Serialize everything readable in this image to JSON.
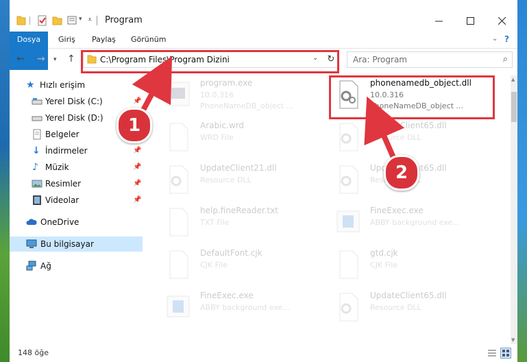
{
  "window": {
    "title": "Program"
  },
  "ribbon": {
    "tabs": [
      "Dosya",
      "Giriş",
      "Paylaş",
      "Görünüm"
    ]
  },
  "navigation": {
    "address": "C:\\Program Files\\Program Dizini",
    "search_placeholder": "Ara: Program"
  },
  "sidebar": {
    "items": [
      {
        "label": "Hızlı erişim",
        "icon": "star-icon"
      },
      {
        "label": "Yerel Disk (C:)",
        "icon": "drive-icon"
      },
      {
        "label": "Yerel Disk (D:)",
        "icon": "drive-icon"
      },
      {
        "label": "Belgeler",
        "icon": "documents-icon"
      },
      {
        "label": "İndirmeler",
        "icon": "download-icon"
      },
      {
        "label": "Müzik",
        "icon": "music-icon"
      },
      {
        "label": "Resimler",
        "icon": "pictures-icon"
      },
      {
        "label": "Videolar",
        "icon": "videos-icon"
      },
      {
        "label": "OneDrive",
        "icon": "cloud-icon"
      },
      {
        "label": "Bu bilgisayar",
        "icon": "computer-icon"
      },
      {
        "label": "Ağ",
        "icon": "network-icon"
      }
    ]
  },
  "files": [
    {
      "name": "program.exe",
      "line2": "10.0.316",
      "line3": "PhoneNameDB_object ..."
    },
    {
      "name": "phonenamedb_object.dll",
      "line2": "10.0.316",
      "line3": "PhoneNameDB_object ..."
    },
    {
      "name": "Arabic.wrd",
      "line2": "WRD File",
      "line3": ""
    },
    {
      "name": "UpdateClient65.dll",
      "line2": "Resource DLL",
      "line3": ""
    },
    {
      "name": "UpdateClient21.dll",
      "line2": "Resource DLL",
      "line3": ""
    },
    {
      "name": "UpdateClient65.dll",
      "line2": "Resource DLL",
      "line3": ""
    },
    {
      "name": "help.fineReader.txt",
      "line2": "TXT File",
      "line3": ""
    },
    {
      "name": "FineExec.exe",
      "line2": "ABBY background exe...",
      "line3": ""
    },
    {
      "name": "DefaultFont.cjk",
      "line2": "CJK File",
      "line3": ""
    },
    {
      "name": "gtd.cjk",
      "line2": "CJK File",
      "line3": ""
    },
    {
      "name": "FineExec.exe",
      "line2": "ABBY background exe...",
      "line3": ""
    },
    {
      "name": "UpdateClient65.dll",
      "line2": "Resource DLL",
      "line3": ""
    }
  ],
  "status": {
    "count": "148 öğe"
  },
  "annotations": {
    "callout1": "1",
    "callout2": "2"
  },
  "colors": {
    "accent": "#1979ca",
    "highlight": "#e0363f",
    "selected": "#cce8ff"
  }
}
